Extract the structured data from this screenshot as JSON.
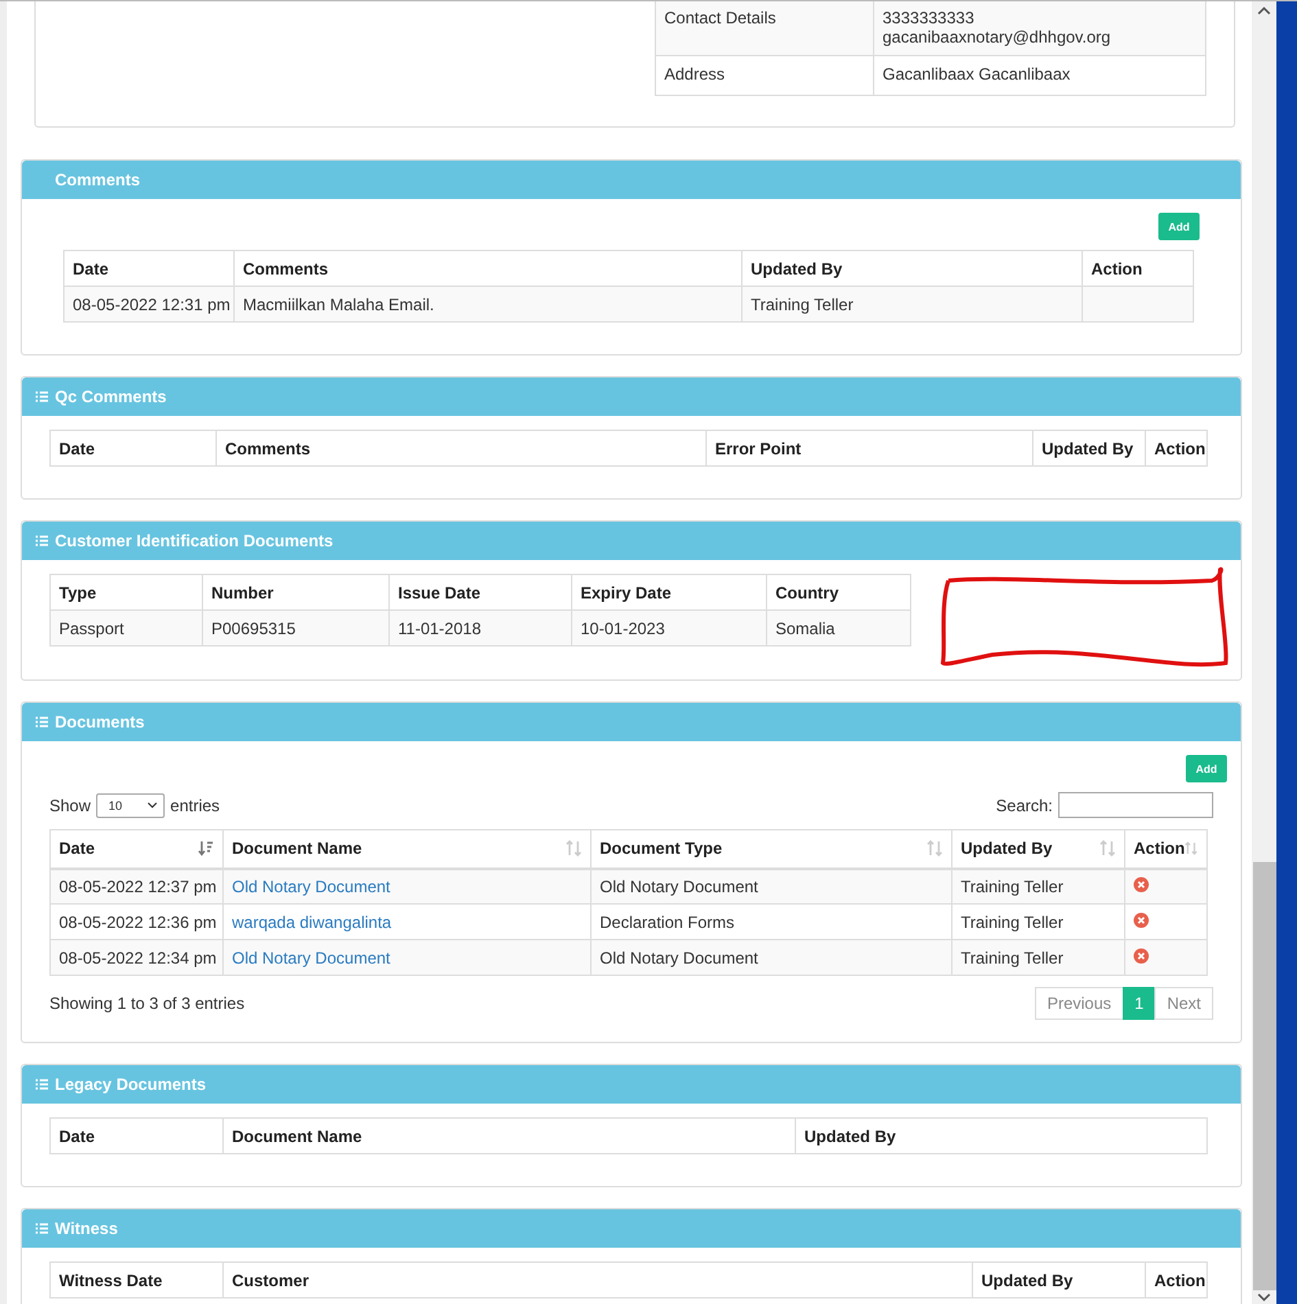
{
  "contact_table": {
    "rows": [
      {
        "label": "Contact Details",
        "values": [
          "3333333333",
          "gacanibaaxnotary@dhhgov.org"
        ]
      },
      {
        "label": "Address",
        "values": [
          "Gacanlibaax Gacanlibaax"
        ]
      }
    ]
  },
  "sections": [
    {
      "title": "Comments",
      "list_icon": false,
      "add_button": "Add",
      "columns": [
        {
          "label": "Date"
        },
        {
          "label": "Comments"
        },
        {
          "label": "Updated By"
        },
        {
          "label": "Action"
        }
      ],
      "rows": [
        {
          "cells": [
            "08-05-2022 12:31 pm",
            "Macmiilkan Malaha Email.",
            "Training Teller"
          ]
        }
      ]
    },
    {
      "title": "Qc Comments",
      "list_icon": true,
      "columns": [
        {
          "label": "Date"
        },
        {
          "label": "Comments"
        },
        {
          "label": "Error Point"
        },
        {
          "label": "Updated By"
        },
        {
          "label": "Action"
        }
      ]
    },
    {
      "title": "Customer Identification Documents",
      "list_icon": true,
      "columns": [
        {
          "label": "Type"
        },
        {
          "label": "Number"
        },
        {
          "label": "Issue Date"
        },
        {
          "label": "Expiry Date"
        },
        {
          "label": "Country"
        }
      ],
      "rows": [
        {
          "cells": [
            "Passport",
            "P00695315",
            "11-01-2018",
            "10-01-2023",
            "Somalia"
          ]
        }
      ]
    },
    {
      "title": "Documents",
      "list_icon": true,
      "add_button": "Add",
      "length_menu": {
        "before": "Show",
        "value": "10",
        "after": "entries"
      },
      "search": {
        "label": "Search:"
      },
      "columns": [
        {
          "label": "Date",
          "sorted": true
        },
        {
          "label": "Document Name",
          "sorted": false,
          "link": true
        },
        {
          "label": "Document Type",
          "sorted": false
        },
        {
          "label": "Updated By",
          "sorted": false
        },
        {
          "label": "Action",
          "sorted": false
        }
      ],
      "rows": [
        {
          "cells": [
            "08-05-2022 12:37 pm",
            "Old Notary Document",
            "Old Notary Document",
            "Training Teller"
          ],
          "deletable": true
        },
        {
          "cells": [
            "08-05-2022 12:36 pm",
            "warqada diwangalinta",
            "Declaration Forms",
            "Training Teller"
          ],
          "deletable": true
        },
        {
          "cells": [
            "08-05-2022 12:34 pm",
            "Old Notary Document",
            "Old Notary Document",
            "Training Teller"
          ],
          "deletable": true
        }
      ],
      "info": "Showing 1 to 3 of 3 entries",
      "pagination": [
        {
          "label": "Previous",
          "selected": false,
          "disabled": true
        },
        {
          "label": "1",
          "selected": true,
          "disabled": false
        },
        {
          "label": "Next",
          "selected": false,
          "disabled": true
        }
      ]
    },
    {
      "title": "Legacy Documents",
      "list_icon": true,
      "columns": [
        {
          "label": "Date"
        },
        {
          "label": "Document Name"
        },
        {
          "label": "Updated By"
        }
      ]
    },
    {
      "title": "Witness",
      "list_icon": true,
      "columns": [
        {
          "label": "Witness Date"
        },
        {
          "label": "Customer"
        },
        {
          "label": "Updated By"
        },
        {
          "label": "Action"
        }
      ]
    }
  ]
}
